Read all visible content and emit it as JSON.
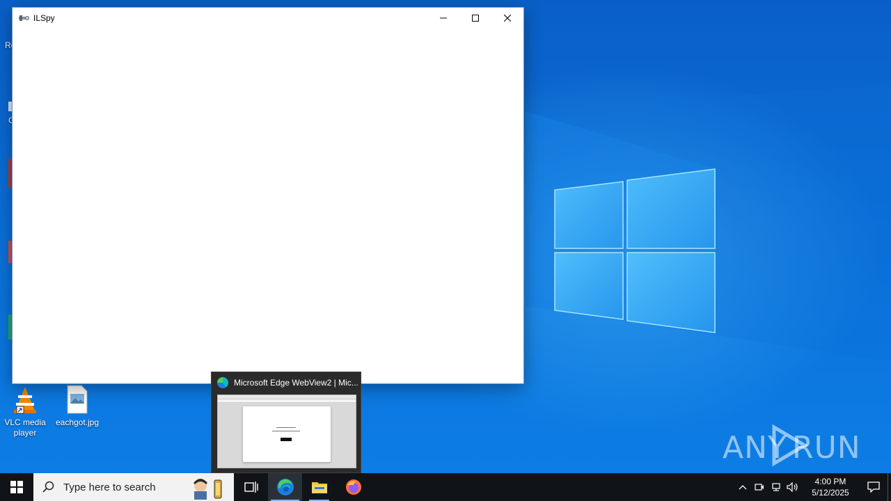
{
  "desktop": {
    "peek_labels": [
      "Re",
      "C"
    ],
    "icons": [
      {
        "label": "VLC media player",
        "icon": "vlc-icon"
      },
      {
        "label": "eachgot.jpg",
        "icon": "image-file-icon"
      }
    ]
  },
  "window": {
    "title": "ILSpy",
    "icon": "ilspy-icon",
    "controls": {
      "minimize": "minimize-icon",
      "maximize": "maximize-icon",
      "close": "close-icon"
    }
  },
  "taskbar_thumbnail": {
    "title": "Microsoft Edge WebView2 | Mic..."
  },
  "taskbar": {
    "search_placeholder": "Type here to search",
    "apps": [
      {
        "name": "task-view",
        "icon": "task-view-icon"
      },
      {
        "name": "edge",
        "icon": "edge-icon"
      },
      {
        "name": "file-explorer",
        "icon": "folder-icon"
      },
      {
        "name": "firefox",
        "icon": "firefox-icon"
      }
    ],
    "tray": {
      "time": "4:00 PM",
      "date": "5/12/2025"
    }
  },
  "watermark": {
    "text": "ANY RUN"
  },
  "colors": {
    "taskbar": "#101418",
    "wallpaper": "#0a6fd8",
    "accent": "#7fb4ef"
  }
}
